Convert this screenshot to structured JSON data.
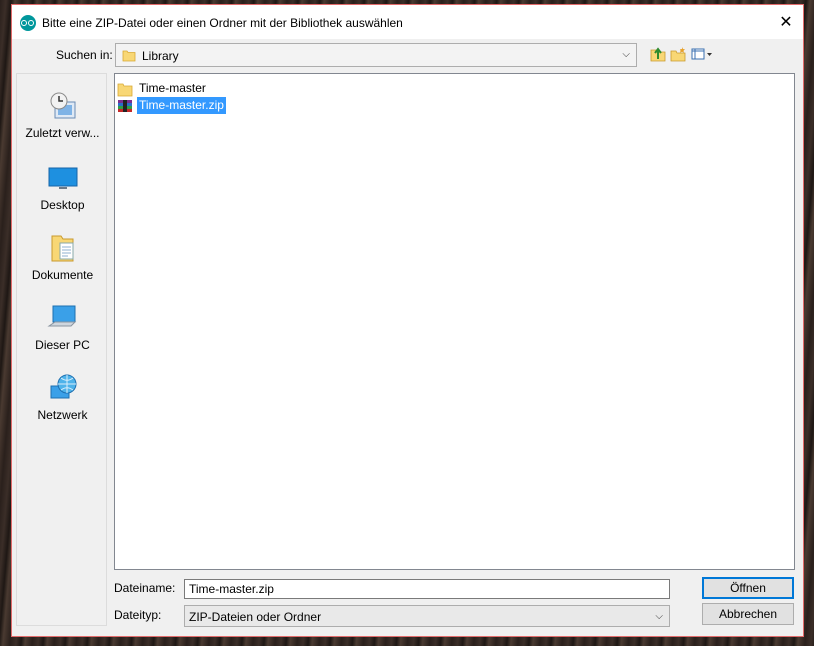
{
  "window": {
    "title": "Bitte eine ZIP-Datei oder einen Ordner mit der Bibliothek auswählen",
    "close_glyph": "✕"
  },
  "lookin": {
    "label": "Suchen in:",
    "value": "Library"
  },
  "toolbar": {
    "icons": [
      "up-folder-icon",
      "new-folder-icon",
      "view-menu-icon"
    ]
  },
  "sidebar": {
    "items": [
      {
        "label": "Zuletzt verw...",
        "icon": "recent-places-icon"
      },
      {
        "label": "Desktop",
        "icon": "desktop-icon"
      },
      {
        "label": "Dokumente",
        "icon": "documents-icon"
      },
      {
        "label": "Dieser PC",
        "icon": "computer-icon"
      },
      {
        "label": "Netzwerk",
        "icon": "network-icon"
      }
    ]
  },
  "files": [
    {
      "name": "Time-master",
      "type": "folder",
      "selected": false
    },
    {
      "name": "Time-master.zip",
      "type": "zip-archive",
      "selected": true
    }
  ],
  "filename": {
    "label": "Dateiname:",
    "value": "Time-master.zip"
  },
  "filetype": {
    "label": "Dateityp:",
    "value": "ZIP-Dateien oder Ordner"
  },
  "buttons": {
    "open": "Öffnen",
    "cancel": "Abbrechen"
  },
  "colors": {
    "selection": "#3399ff",
    "default_button_border": "#0078d7",
    "window_border": "#e26b6b"
  }
}
